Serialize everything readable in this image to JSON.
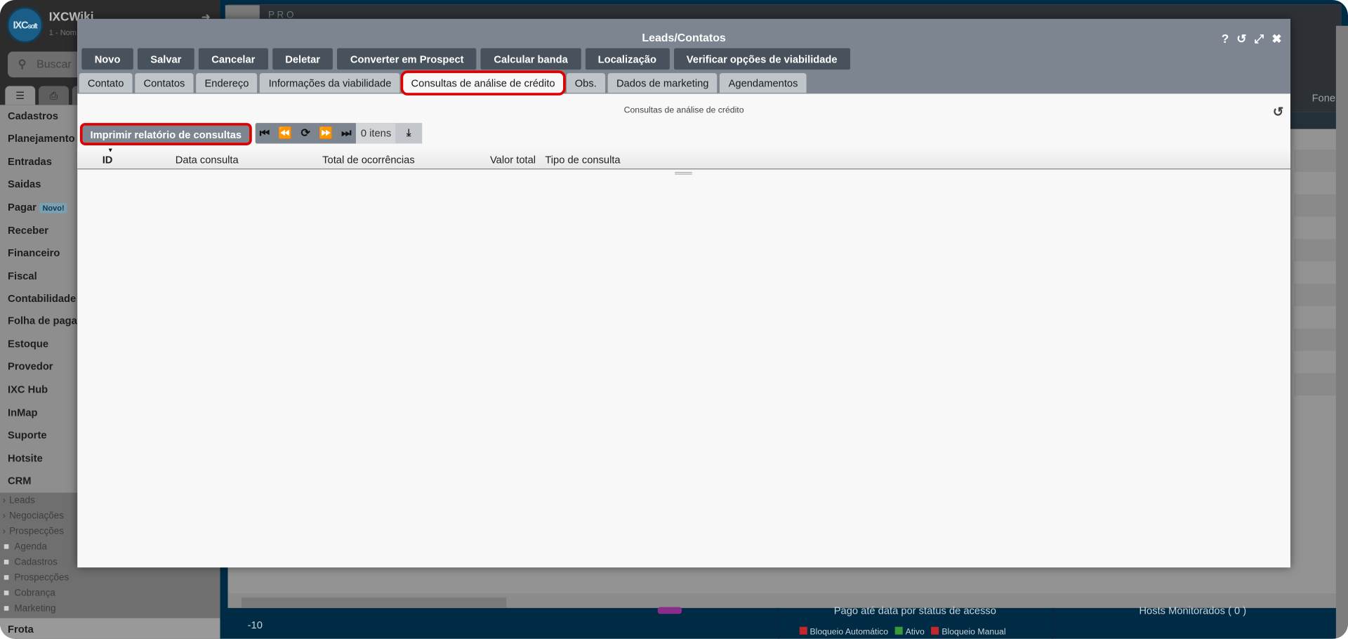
{
  "sidebar": {
    "app_name": "IXCWiki",
    "app_sub": "1 - Nom",
    "logo_text": "IXCsoft",
    "search_placeholder": "Buscar",
    "menu": [
      "Cadastros",
      "Planejamento",
      "Entradas",
      "Saidas",
      "Pagar",
      "Receber",
      "Financeiro",
      "Fiscal",
      "Contabilidade",
      "Folha de pagar",
      "Estoque",
      "Provedor",
      "IXC Hub",
      "InMap",
      "Suporte",
      "Hotsite",
      "CRM"
    ],
    "pagar_badge": "Novo!",
    "crm_sub": [
      "Leads",
      "Negociações",
      "Prospecções"
    ],
    "crm_folders": [
      "Agenda",
      "Cadastros",
      "Prospecções",
      "Cobrança",
      "Marketing"
    ],
    "last": "Frota"
  },
  "background": {
    "col_header": "Fone c",
    "axis_tick": "-10",
    "chart1_title": "Pago até data por status de acesso",
    "chart2_title": "Hosts Monitorados ( 0 )",
    "legend": [
      {
        "label": "Bloqueio Automático",
        "color": "#c0282b"
      },
      {
        "label": "Ativo",
        "color": "#3a9a3a"
      },
      {
        "label": "Bloqueio Manual",
        "color": "#c0282b"
      }
    ],
    "bg_tab": "P R O"
  },
  "modal": {
    "title": "Leads/Contatos",
    "buttons": [
      "Novo",
      "Salvar",
      "Cancelar",
      "Deletar",
      "Converter em Prospect",
      "Calcular banda",
      "Localização",
      "Verificar opções de viabilidade"
    ],
    "tabs": [
      "Contato",
      "Contatos",
      "Endereço",
      "Informações da viabilidade",
      "Consultas de análise de crédito",
      "Obs.",
      "Dados de marketing",
      "Agendamentos"
    ],
    "active_tab": "Consultas de análise de crédito",
    "content_title": "Consultas de análise de crédito",
    "print_button": "Imprimir relatório de consultas",
    "item_count": "0 itens",
    "columns": [
      "ID",
      "Data consulta",
      "Total de ocorrências",
      "Valor total",
      "Tipo de consulta"
    ],
    "sort_column": "ID",
    "rows": []
  },
  "colors": {
    "highlight": "#e00000",
    "header": "#7d8690",
    "button": "#48525c"
  }
}
